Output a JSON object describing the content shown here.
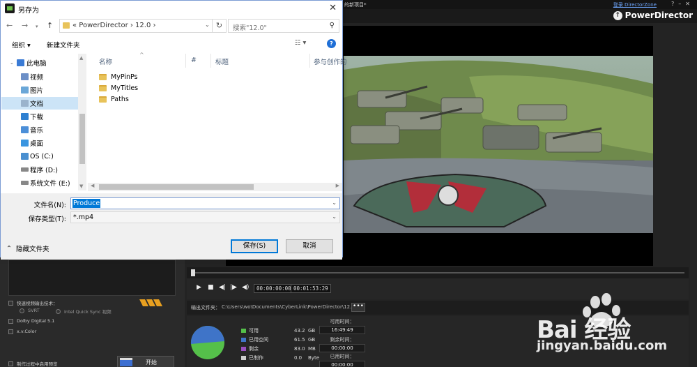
{
  "pd": {
    "window_title": "的新项目*",
    "login_link": "登录 DirectorZone",
    "brand": "PowerDirector",
    "timecode_current": "00:00:00:00",
    "timecode_total": "00:01:53:29",
    "output_label": "输出文件夹：",
    "output_path": "C:\\Users\\wo\\Documents\\CyberLink\\PowerDirector\\12.0\\Pro",
    "more_btn": "•••",
    "legend": [
      {
        "label": "可用",
        "value": "43.2",
        "unit": "GB",
        "color": "#55c04a"
      },
      {
        "label": "已用空间",
        "value": "61.5",
        "unit": "GB",
        "color": "#3f74c8"
      },
      {
        "label": "剩余",
        "value": "83.0",
        "unit": "MB",
        "color": "#9a50c0"
      },
      {
        "label": "已制作",
        "value": "0.0",
        "unit": "Byte",
        "color": "#cccccc"
      }
    ],
    "times": [
      {
        "label": "可用时间：",
        "value": "16:49:49"
      },
      {
        "label": "剩余时间：",
        "value": "00:00:00"
      },
      {
        "label": "已用时间：",
        "value": "00:00:00"
      }
    ],
    "fast_render_label": "快速视频输出技术：",
    "svrt": "SVRT",
    "intel": "Intel Quick Sync 视频",
    "dolby": "Dolby Digital 5.1",
    "xvcolor": "x.v.Color",
    "preview_during": "制作过程中启用预览",
    "start_btn": "开始"
  },
  "watermark": {
    "brand": "Bai 经验",
    "url": "jingyan.baidu.com"
  },
  "dialog": {
    "title": "另存为",
    "close": "✕",
    "breadcrumb": "«  PowerDirector  ›  12.0  ›",
    "search_placeholder": "搜索\"12.0\"",
    "organize": "组织 ▾",
    "new_folder": "新建文件夹",
    "tree": [
      {
        "label": "此电脑",
        "icon": "computer-icon",
        "color": "#3a7bd5"
      },
      {
        "label": "视频",
        "icon": "video-icon",
        "color": "#6c8fc7"
      },
      {
        "label": "图片",
        "icon": "pictures-icon",
        "color": "#6aa7d8"
      },
      {
        "label": "文档",
        "icon": "documents-icon",
        "color": "#9bb3cc"
      },
      {
        "label": "下载",
        "icon": "download-icon",
        "color": "#2f80d1"
      },
      {
        "label": "音乐",
        "icon": "music-icon",
        "color": "#4c8fd8"
      },
      {
        "label": "桌面",
        "icon": "desktop-icon",
        "color": "#3a95e0"
      },
      {
        "label": "OS (C:)",
        "icon": "drive-icon",
        "color": "#4a8fd0"
      },
      {
        "label": "程序 (D:)",
        "icon": "drive-icon",
        "color": "#888888"
      },
      {
        "label": "系统文件 (E:)",
        "icon": "drive-icon",
        "color": "#888888"
      }
    ],
    "columns": {
      "name": "名称",
      "num": "#",
      "title": "标题",
      "participants": "参与创作的"
    },
    "files": [
      "MyPinPs",
      "MyTitles",
      "Paths"
    ],
    "filename_label": "文件名(N):",
    "filename_value": "Produce",
    "filetype_label": "保存类型(T):",
    "filetype_value": "*.mp4",
    "hide_folders": "隐藏文件夹",
    "save": "保存(S)",
    "cancel": "取消"
  }
}
